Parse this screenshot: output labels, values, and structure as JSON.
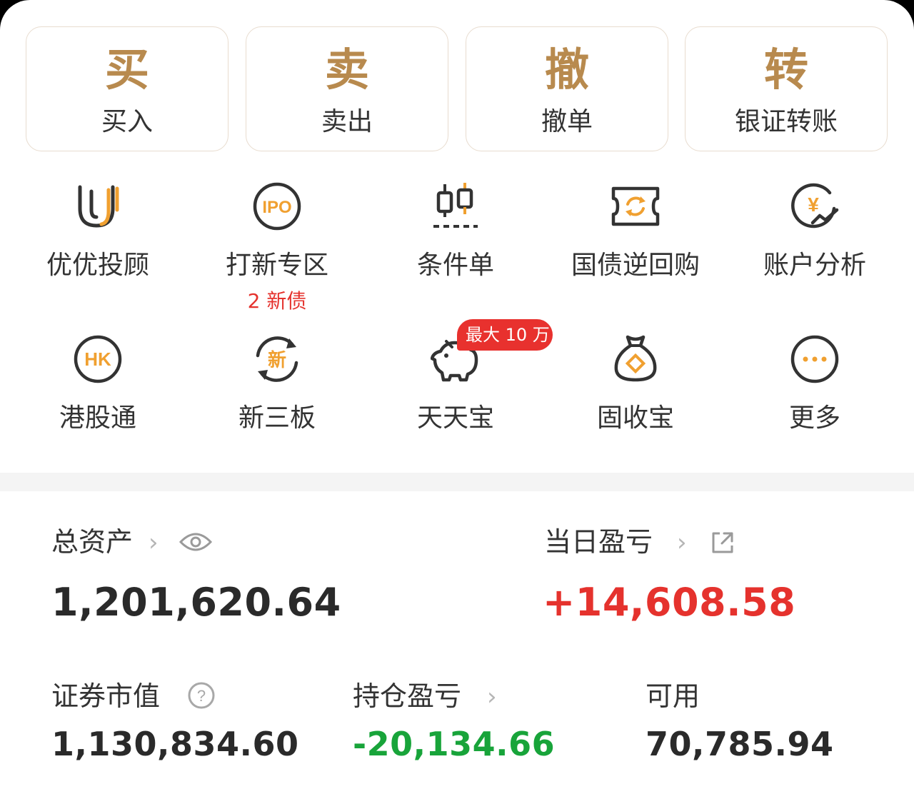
{
  "trade": [
    {
      "big": "买",
      "label": "买入"
    },
    {
      "big": "卖",
      "label": "卖出"
    },
    {
      "big": "撤",
      "label": "撤单"
    },
    {
      "big": "转",
      "label": "银证转账"
    }
  ],
  "grid_row1": [
    {
      "icon": "uu-advisor-icon",
      "label": "优优投顾"
    },
    {
      "icon": "ipo-icon",
      "icon_text": "IPO",
      "label": "打新专区",
      "sub": "2 新债"
    },
    {
      "icon": "candlestick-icon",
      "label": "条件单"
    },
    {
      "icon": "bond-repo-icon",
      "label": "国债逆回购"
    },
    {
      "icon": "account-analysis-icon",
      "icon_text": "¥",
      "label": "账户分析"
    }
  ],
  "grid_row2": [
    {
      "icon": "hk-icon",
      "icon_text": "HK",
      "label": "港股通"
    },
    {
      "icon": "new-third-board-icon",
      "icon_text": "新",
      "label": "新三板"
    },
    {
      "icon": "piggy-bank-icon",
      "label": "天天宝",
      "badge": "最大 10 万"
    },
    {
      "icon": "money-bag-icon",
      "label": "固收宝"
    },
    {
      "icon": "more-icon",
      "label": "更多"
    }
  ],
  "assets": {
    "total_label": "总资产",
    "total_value": "1,201,620.64",
    "daily_pl_label": "当日盈亏",
    "daily_pl_value": "+14,608.58",
    "market_value_label": "证券市值",
    "market_value": "1,130,834.60",
    "holding_pl_label": "持仓盈亏",
    "holding_pl_value": "-20,134.66",
    "available_label": "可用",
    "available_value": "70,785.94"
  },
  "colors": {
    "gold": "#b88a4e",
    "icon_orange": "#f0a030",
    "red": "#e5322d",
    "green": "#18a43a"
  }
}
